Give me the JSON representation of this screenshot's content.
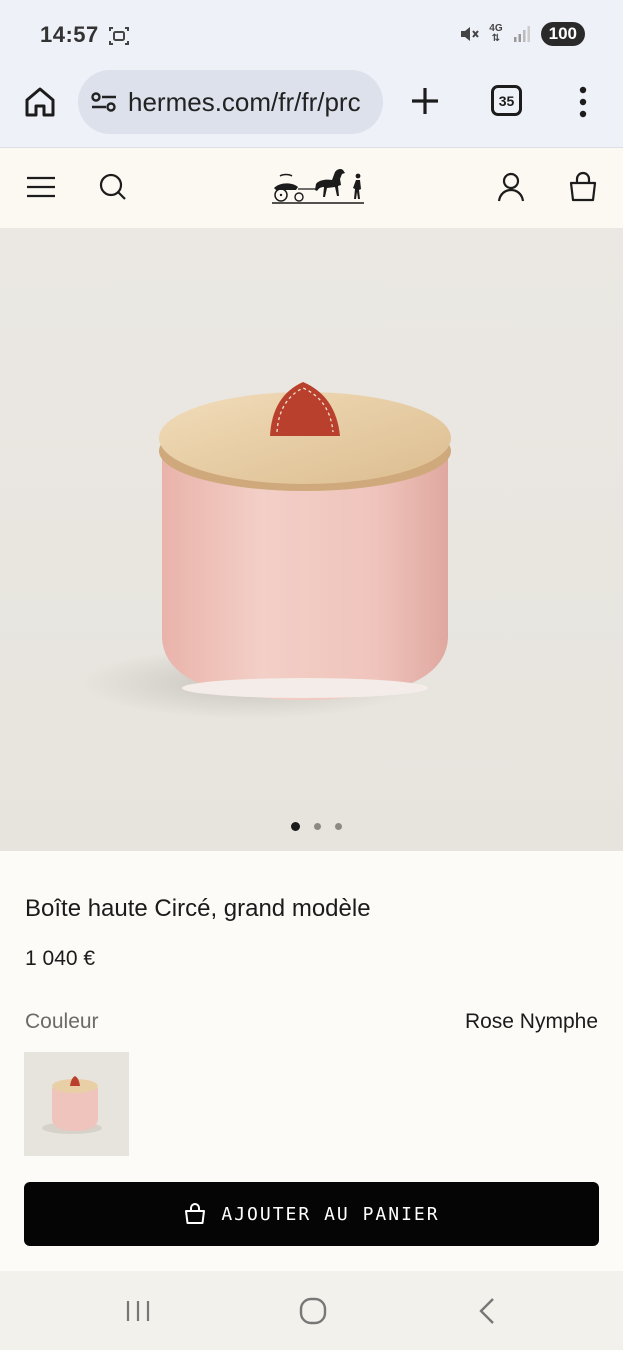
{
  "status_bar": {
    "time": "14:57",
    "battery": "100",
    "network": "4G",
    "icons": [
      "screenshot-icon",
      "mute-icon",
      "signal-icon"
    ]
  },
  "browser": {
    "url": "hermes.com/fr/fr/prc",
    "tab_count": "35",
    "icons": [
      "home-icon",
      "site-info-icon",
      "new-tab-icon",
      "more-menu-icon"
    ]
  },
  "site_header": {
    "icons": [
      "menu-icon",
      "search-icon",
      "hermes-logo",
      "account-icon",
      "shopping-bag-icon"
    ]
  },
  "gallery": {
    "slide_count": 3,
    "active_index": 0
  },
  "product": {
    "title": "Boîte haute Circé, grand modèle",
    "price": "1 040 €",
    "color_label": "Couleur",
    "color_value": "Rose Nymphe",
    "add_to_cart": "AJOUTER AU PANIER"
  },
  "nav_bar": {
    "icons": [
      "recent-apps-icon",
      "home-nav-icon",
      "back-icon"
    ]
  },
  "colors": {
    "product_pink": "#efc4bc",
    "lid_wood": "#e9cfa6",
    "leather_tab": "#b8402c",
    "button_black": "#050505"
  }
}
